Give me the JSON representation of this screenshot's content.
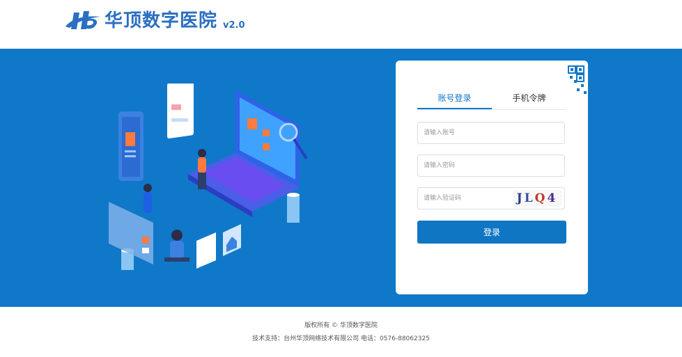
{
  "header": {
    "logo_name": "华顶数字医院",
    "version": "v2.0"
  },
  "login": {
    "tabs": [
      {
        "label": "账号登录",
        "active": true
      },
      {
        "label": "手机令牌",
        "active": false
      }
    ],
    "username_placeholder": "请输入账号",
    "password_placeholder": "请输入密码",
    "captcha_placeholder": "请输入验证码",
    "captcha_chars": [
      "J",
      "L",
      "Q",
      "4"
    ],
    "login_label": "登录"
  },
  "footer": {
    "copyright": "版权所有 © 华顶数字医院",
    "support": "技术支持：台州华顶网络技术有限公司 电话：0576-88062325"
  },
  "colors": {
    "brand": "#1078c8",
    "logo": "#2a6fc1",
    "button": "#0f76c4"
  }
}
